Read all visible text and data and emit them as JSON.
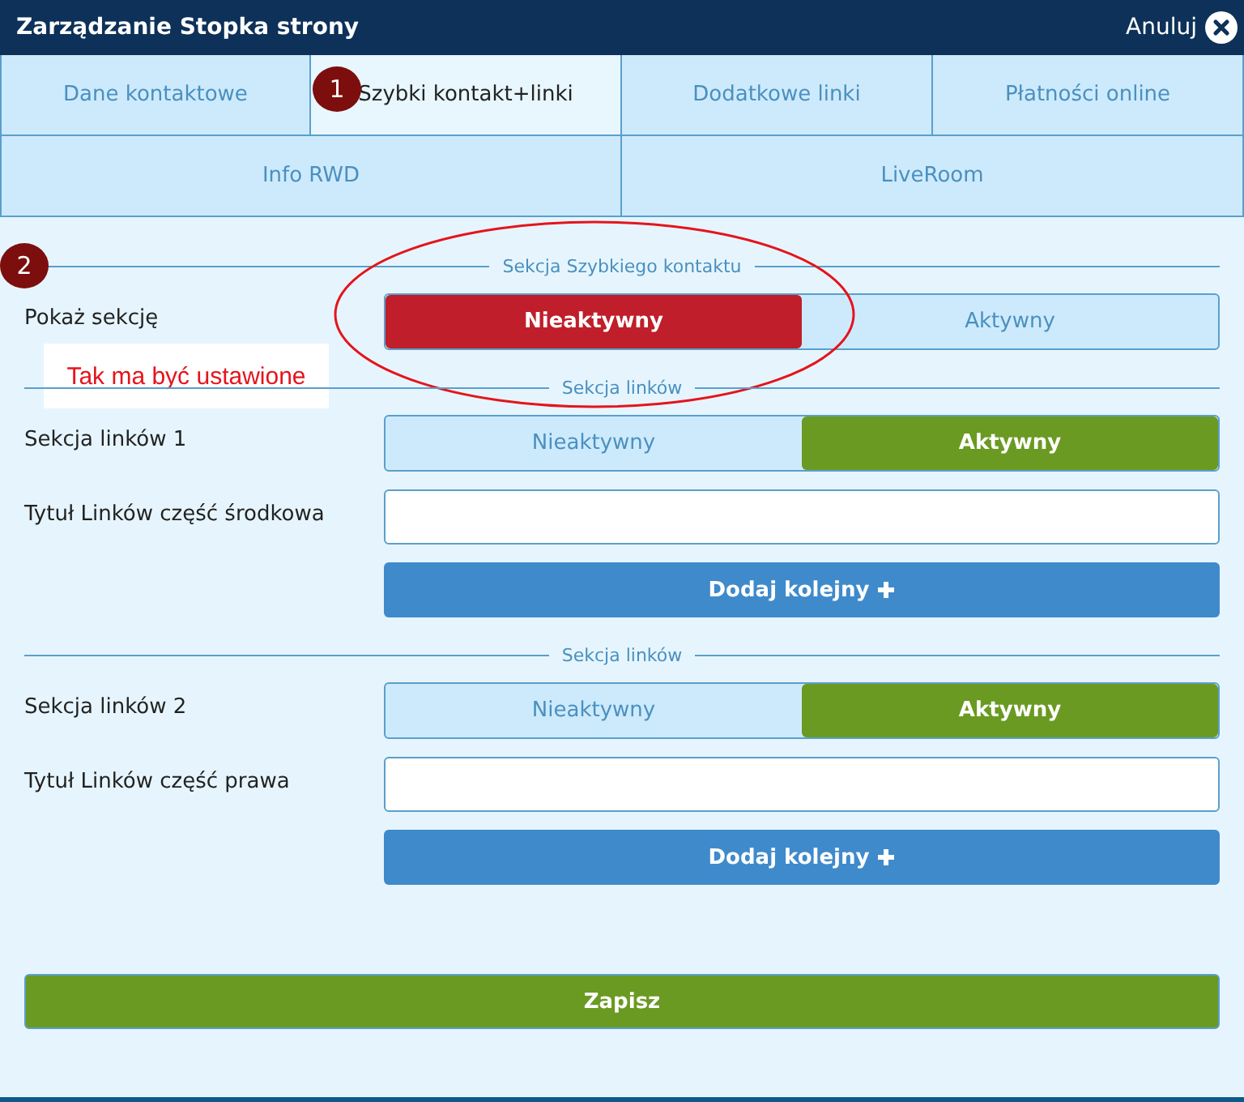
{
  "window": {
    "title": "Zarządzanie Stopka strony",
    "cancel": "Anuluj"
  },
  "tab_rows": [
    {
      "tabs": [
        {
          "label": "Dane kontaktowe",
          "selected": false
        },
        {
          "label": "Szybki kontakt+linki",
          "selected": true,
          "marker": "1"
        },
        {
          "label": "Dodatkowe linki",
          "selected": false
        },
        {
          "label": "Płatności online",
          "selected": false
        }
      ]
    },
    {
      "tabs": [
        {
          "label": "Info RWD",
          "selected": false
        },
        {
          "label": "LiveRoom",
          "selected": false
        }
      ]
    }
  ],
  "sections": [
    {
      "legend": "Sekcja Szybkiego kontaktu",
      "marker": "2",
      "callout": "Tak ma być ustawione",
      "circled": true,
      "rows": [
        {
          "kind": "toggle",
          "label": "Pokaż sekcję",
          "options": [
            {
              "label": "Nieaktywny",
              "selected": true
            },
            {
              "label": "Aktywny",
              "selected": false
            }
          ]
        }
      ]
    },
    {
      "legend": "Sekcja linków",
      "rows": [
        {
          "kind": "toggle",
          "label": "Sekcja linków 1",
          "options": [
            {
              "label": "Nieaktywny",
              "selected": false
            },
            {
              "label": "Aktywny",
              "selected": true
            }
          ]
        },
        {
          "kind": "input",
          "label": "Tytuł Linków część środkowa"
        },
        {
          "kind": "add",
          "button": "Dodaj kolejny"
        }
      ]
    },
    {
      "legend": "Sekcja linków",
      "rows": [
        {
          "kind": "toggle",
          "label": "Sekcja linków 2",
          "options": [
            {
              "label": "Nieaktywny",
              "selected": false
            },
            {
              "label": "Aktywny",
              "selected": true
            }
          ]
        },
        {
          "kind": "input",
          "label": "Tytuł Linków część prawa"
        },
        {
          "kind": "add",
          "button": "Dodaj kolejny"
        }
      ]
    }
  ],
  "save": "Zapisz"
}
